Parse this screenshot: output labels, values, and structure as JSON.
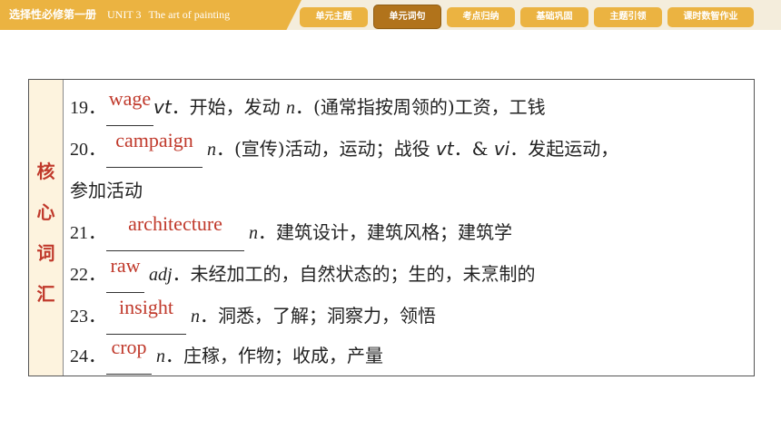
{
  "header": {
    "book": "选择性必修第一册",
    "unit": "UNIT 3",
    "topic": "The art of painting"
  },
  "nav": {
    "tabs": [
      "单元主题",
      "单元词句",
      "考点归纳",
      "基础巩固",
      "主题引领",
      "课时数智作业"
    ],
    "active": "单元词句"
  },
  "section_label": [
    "核",
    "心",
    "词",
    "汇"
  ],
  "entries": [
    {
      "num": "19．",
      "answer": "wage",
      "def": [
        {
          "t": "vt",
          "k": "pos-sans"
        },
        {
          "t": "．开始，发动  ",
          "k": "meaning"
        },
        {
          "t": "n",
          "k": "pos"
        },
        {
          "t": "．(通常指按周领的)工资，工钱",
          "k": "meaning"
        }
      ]
    },
    {
      "num": "20．",
      "answer": "campaign",
      "def": [
        {
          "t": " n",
          "k": "pos"
        },
        {
          "t": "．(宣传)活动，运动；战役  ",
          "k": "meaning"
        },
        {
          "t": "vt",
          "k": "pos-sans"
        },
        {
          "t": "．& ",
          "k": "meaning"
        },
        {
          "t": "vi",
          "k": "pos-sans"
        },
        {
          "t": "．发起运动，",
          "k": "meaning"
        }
      ]
    },
    {
      "num": "",
      "answer": "",
      "def": [
        {
          "t": "参加活动",
          "k": "meaning"
        }
      ]
    },
    {
      "num": "21．",
      "answer": "architecture",
      "def": [
        {
          "t": " n",
          "k": "pos"
        },
        {
          "t": "．建筑设计，建筑风格；建筑学",
          "k": "meaning"
        }
      ]
    },
    {
      "num": "22．",
      "answer": "raw",
      "def": [
        {
          "t": " adj",
          "k": "pos"
        },
        {
          "t": "．未经加工的，自然状态的；生的，未烹制的",
          "k": "meaning"
        }
      ]
    },
    {
      "num": "23．",
      "answer": "insight",
      "def": [
        {
          "t": " n",
          "k": "pos"
        },
        {
          "t": "．洞悉，了解；洞察力，领悟",
          "k": "meaning"
        }
      ]
    },
    {
      "num": "24．",
      "answer": "crop",
      "def": [
        {
          "t": " n",
          "k": "pos"
        },
        {
          "t": "．庄稼，作物；收成，产量",
          "k": "meaning"
        }
      ]
    }
  ],
  "colors": {
    "accent": "#ebb341",
    "active_tab": "#b1731b",
    "answer_red": "#c0392b",
    "side_bg": "#fdf3de"
  }
}
